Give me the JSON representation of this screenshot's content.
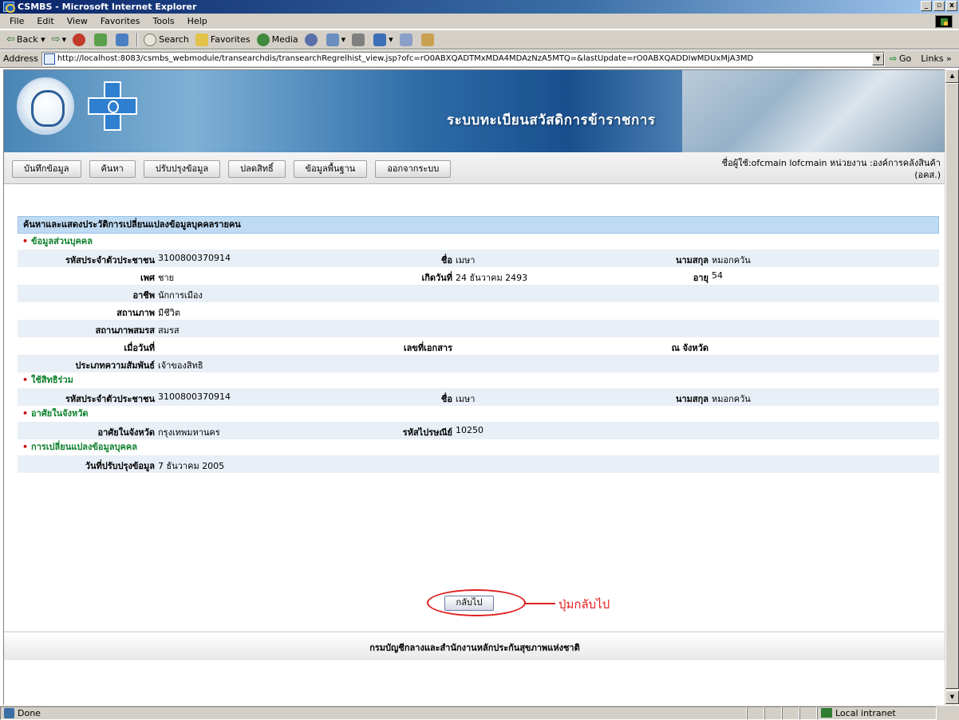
{
  "window": {
    "title": "CSMBS - Microsoft Internet Explorer",
    "controls": [
      "_",
      "▫",
      "x"
    ]
  },
  "menu": [
    "File",
    "Edit",
    "View",
    "Favorites",
    "Tools",
    "Help"
  ],
  "toolbar": {
    "back": "Back",
    "search": "Search",
    "favorites": "Favorites",
    "media": "Media"
  },
  "address": {
    "label": "Address",
    "url": "http://localhost:8083/csmbs_webmodule/transearchdis/transearchRegrelhist_view.jsp?ofc=rO0ABXQADTMxMDA4MDAzNzA5MTQ=&lastUpdate=rO0ABXQADDIwMDUxMjA3MD",
    "go": "Go",
    "links": "Links »"
  },
  "status": {
    "text": "Done",
    "zone": "Local intranet"
  },
  "banner": {
    "system_title": "ระบบทะเบียนสวัสดิการข้าราชการ"
  },
  "nav": {
    "buttons": [
      "บันทึกข้อมูล",
      "ค้นหา",
      "ปรับปรุงข้อมูล",
      "ปลดสิทธิ์",
      "ข้อมูลพื้นฐาน",
      "ออกจากระบบ"
    ],
    "user_line1": "ชื่อผู้ใช้:ofcmain lofcmain หน่วยงาน :องค์การคลังสินค้า",
    "user_line2": "(อคส.)"
  },
  "form": {
    "section_title": "ค้นหาและแสดงประวัติการเปลี่ยนแปลงข้อมูลบุคคลรายคน",
    "personal": {
      "title": "ข้อมูลส่วนบุคคล",
      "id_label": "รหัสประจำตัวประชาชน",
      "id_value": "3100800370914",
      "name_label": "ชื่อ",
      "name_value": "เมษา",
      "surname_label": "นามสกุล",
      "surname_value": "หมอกควัน",
      "gender_label": "เพศ",
      "gender_value": "ชาย",
      "birth_label": "เกิดวันที่",
      "birth_value": "24 ธันวาคม 2493",
      "age_label": "อายุ",
      "age_value": "54",
      "occupation_label": "อาชีพ",
      "occupation_value": "นักการเมือง",
      "status_label": "สถานภาพ",
      "status_value": "มีชีวิต",
      "marital_label": "สถานภาพสมรส",
      "marital_value": "สมรส",
      "date_label": "เมื่อวันที่",
      "doc_label": "เลขที่เอกสาร",
      "province_label": "ณ จังหวัด",
      "relation_label": "ประเภทความสัมพันธ์",
      "relation_value": "เจ้าของสิทธิ"
    },
    "shared": {
      "title": "ใช้สิทธิร่วม",
      "id_label": "รหัสประจำตัวประชาชน",
      "id_value": "3100800370914",
      "name_label": "ชื่อ",
      "name_value": "เมษา",
      "surname_label": "นามสกุล",
      "surname_value": "หมอกควัน"
    },
    "residence": {
      "title": "อาศัยในจังหวัด",
      "province_label": "อาศัยในจังหวัด",
      "province_value": "กรุงเทพมหานคร",
      "postal_label": "รหัสไปรษณีย์",
      "postal_value": "10250"
    },
    "change": {
      "title": "การเปลี่ยนแปลงข้อมูลบุคคล",
      "update_label": "วันที่ปรับปรุงข้อมูล",
      "update_value": "7 ธันวาคม 2005"
    },
    "back_button": "กลับไป",
    "callout": "ปุ่มกลับไป"
  },
  "footer": "กรมบัญชีกลางและสำนักงานหลักประกันสุขภาพแห่งชาติ"
}
